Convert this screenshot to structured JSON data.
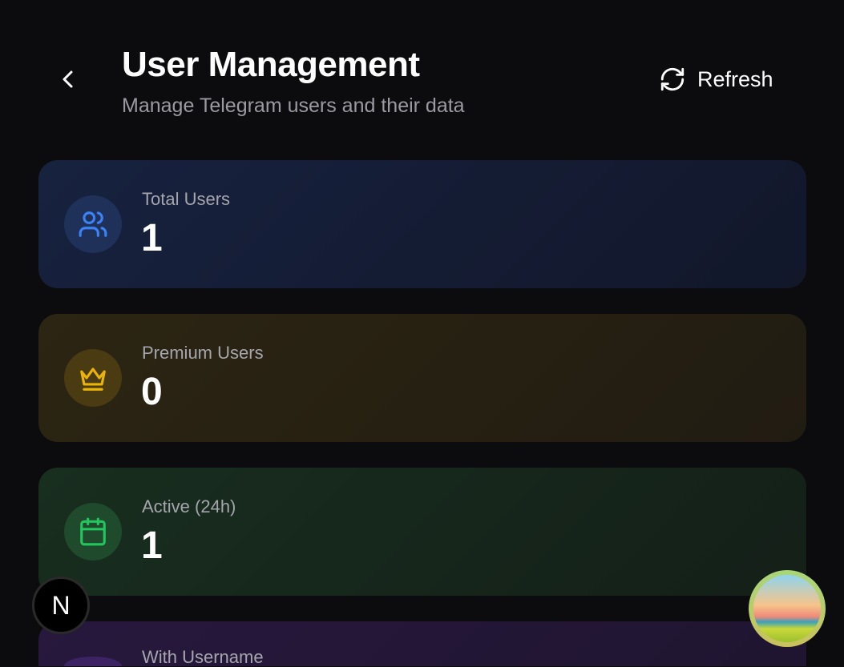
{
  "header": {
    "title": "User Management",
    "subtitle": "Manage Telegram users and their data",
    "refresh_label": "Refresh"
  },
  "stats": [
    {
      "label": "Total Users",
      "value": "1",
      "icon": "users-icon",
      "color": "#3b82f6"
    },
    {
      "label": "Premium Users",
      "value": "0",
      "icon": "crown-icon",
      "color": "#eab308"
    },
    {
      "label": "Active (24h)",
      "value": "1",
      "icon": "calendar-icon",
      "color": "#22c55e"
    },
    {
      "label": "With Username",
      "icon": "at-icon",
      "color": "#a855f7"
    }
  ],
  "overlay": {
    "dev_badge": "N"
  }
}
